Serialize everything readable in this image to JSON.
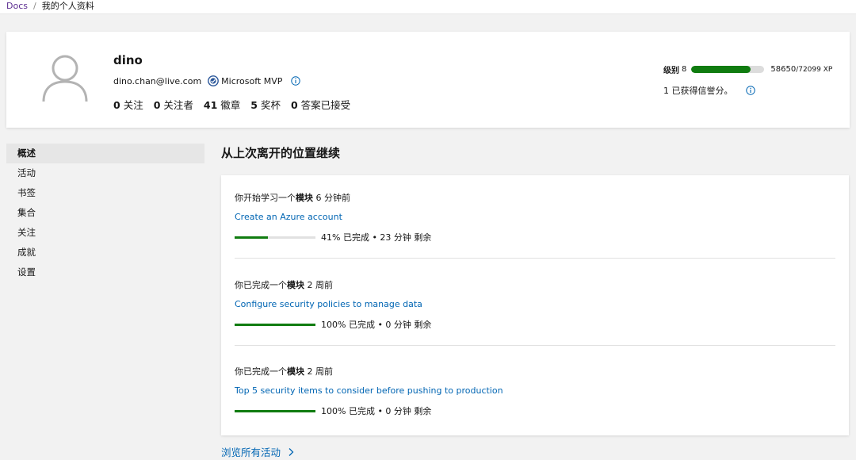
{
  "breadcrumb": {
    "root": "Docs",
    "separator": "/",
    "current": "我的个人资料"
  },
  "profile": {
    "name": "dino",
    "email": "dino.chan@live.com",
    "badge": "Microsoft MVP",
    "stats": [
      {
        "value": "0",
        "label": "关注"
      },
      {
        "value": "0",
        "label": "关注者"
      },
      {
        "value": "41",
        "label": "徽章"
      },
      {
        "value": "5",
        "label": "奖杯"
      },
      {
        "value": "0",
        "label": "答案已接受"
      }
    ]
  },
  "level": {
    "label": "级别",
    "value": "8",
    "xp_current": "58650",
    "xp_total": "/72099 XP",
    "xp_fraction": 0.81,
    "reputation": "1 已获得信誉分。"
  },
  "sidebar": {
    "items": [
      {
        "label": "概述",
        "active": true
      },
      {
        "label": "活动",
        "active": false
      },
      {
        "label": "书签",
        "active": false
      },
      {
        "label": "集合",
        "active": false
      },
      {
        "label": "关注",
        "active": false
      },
      {
        "label": "成就",
        "active": false
      },
      {
        "label": "设置",
        "active": false
      }
    ]
  },
  "main": {
    "title": "从上次离开的位置继续",
    "activities": [
      {
        "prefix": "你开始学习一个",
        "kind": "模块",
        "when": " 6 分钟前",
        "title": "Create an Azure account",
        "progress_fraction": 0.41,
        "status": "41% 已完成 • 23 分钟 剩余"
      },
      {
        "prefix": "你已完成一个",
        "kind": "模块",
        "when": " 2 周前",
        "title": "Configure security policies to manage data",
        "progress_fraction": 1.0,
        "status": "100% 已完成 • 0 分钟 剩余"
      },
      {
        "prefix": "你已完成一个",
        "kind": "模块",
        "when": " 2 周前",
        "title": "Top 5 security items to consider before pushing to production",
        "progress_fraction": 1.0,
        "status": "100% 已完成 • 0 分钟 剩余"
      }
    ],
    "browse_all": "浏览所有活动"
  },
  "colors": {
    "accent_green": "#107c10",
    "link_blue": "#0065b3",
    "breadcrumb_purple": "#5c2d91"
  },
  "icons": {
    "avatar": "person-outline-icon",
    "badge": "mvp-badge-icon",
    "info": "info-circle-icon",
    "chevron": "chevron-right-icon"
  }
}
